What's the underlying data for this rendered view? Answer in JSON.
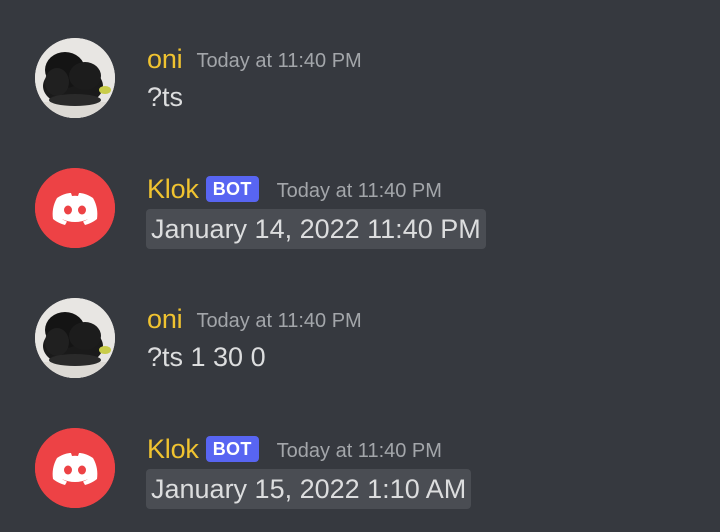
{
  "messages": [
    {
      "author": "oni",
      "is_bot": false,
      "timestamp": "Today at 11:40 PM",
      "content": "?ts",
      "avatar_icon": "dog-photo-avatar"
    },
    {
      "author": "Klok",
      "is_bot": true,
      "badge": "BOT",
      "timestamp": "Today at 11:40 PM",
      "content": "January 14, 2022 11:40 PM",
      "avatar_icon": "discord-logo-icon"
    },
    {
      "author": "oni",
      "is_bot": false,
      "timestamp": "Today at 11:40 PM",
      "content": "?ts 1 30 0",
      "avatar_icon": "dog-photo-avatar"
    },
    {
      "author": "Klok",
      "is_bot": true,
      "badge": "BOT",
      "timestamp": "Today at 11:40 PM",
      "content": "January 15, 2022 1:10 AM",
      "avatar_icon": "discord-logo-icon"
    }
  ],
  "colors": {
    "background": "#36393f",
    "username": "#f0c330",
    "bot_badge": "#5865f2",
    "bot_avatar": "#ed4245",
    "timestamp": "#a3a6aa",
    "text": "#dcddde",
    "chip": "#4a4d53"
  }
}
